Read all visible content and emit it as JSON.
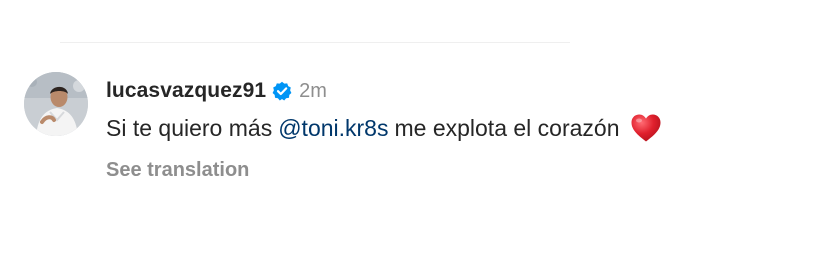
{
  "comment": {
    "username": "lucasvazquez91",
    "verified": true,
    "time": "2m",
    "text_before": "Si te quiero más",
    "mention": "@toni.kr8s",
    "text_after": "me explota el corazón",
    "emoji_icon": "red-heart-icon",
    "see_translation": "See translation"
  },
  "colors": {
    "mention": "#00376b",
    "verified_badge": "#0095f6",
    "secondary_text": "#8e8e8e",
    "primary_text": "#262626",
    "heart": "#e0202d"
  }
}
